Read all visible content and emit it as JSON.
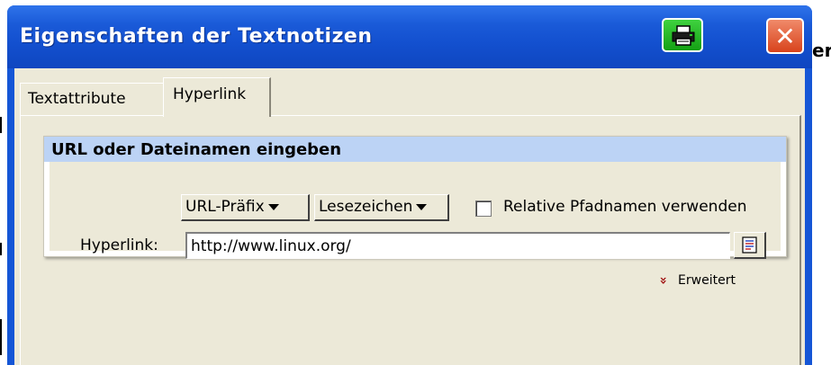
{
  "window": {
    "title": "Eigenschaften der Textnotizen",
    "close_label": "✕"
  },
  "background": {
    "partial_text": "er"
  },
  "tabs": [
    {
      "label": "Textattribute",
      "active": false
    },
    {
      "label": "Hyperlink",
      "active": true
    }
  ],
  "group": {
    "title": "URL oder Dateinamen eingeben",
    "url_prefix_button": "URL-Präfix",
    "bookmarks_button": "Lesezeichen",
    "relative_paths": {
      "label": "Relative Pfadnamen verwenden",
      "checked": false
    },
    "hyperlink_label": "Hyperlink:",
    "hyperlink_value": "http://www.linux.org/"
  },
  "advanced": {
    "label": "Erweitert"
  },
  "colors": {
    "titlebar": "#1556d6",
    "group_header": "#bcd3f5",
    "dialog_face": "#ece9d8",
    "print_button": "#2bb82b",
    "close_button": "#d8431c",
    "advanced_chevron": "#a01010"
  }
}
